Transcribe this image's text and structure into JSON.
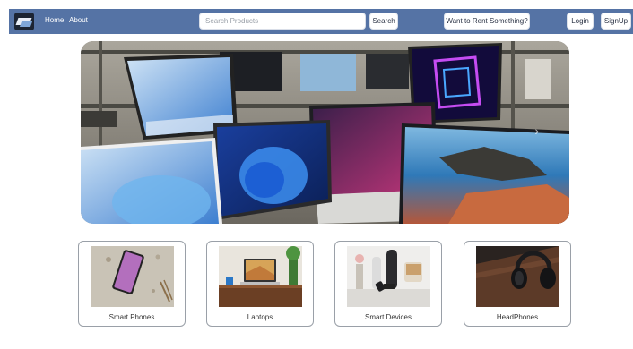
{
  "nav": {
    "logo_icon": "laptop-logo-icon",
    "links": {
      "home": "Home",
      "about": "About"
    },
    "search": {
      "placeholder": "Search Products",
      "button": "Search"
    },
    "rent_button": "Want to Rent Something?",
    "login": "Login",
    "signup": "SignUp"
  },
  "hero": {
    "image": "laptops-display-banner",
    "next_arrow": "›"
  },
  "categories": [
    {
      "label": "Smart Phones",
      "image": "smartphone-on-marble"
    },
    {
      "label": "Laptops",
      "image": "laptop-on-desk"
    },
    {
      "label": "Smart Devices",
      "image": "smart-speakers"
    },
    {
      "label": "HeadPhones",
      "image": "headphones-on-table"
    }
  ],
  "colors": {
    "navbar": "#5573a5",
    "card_border": "#9aa0a8"
  }
}
